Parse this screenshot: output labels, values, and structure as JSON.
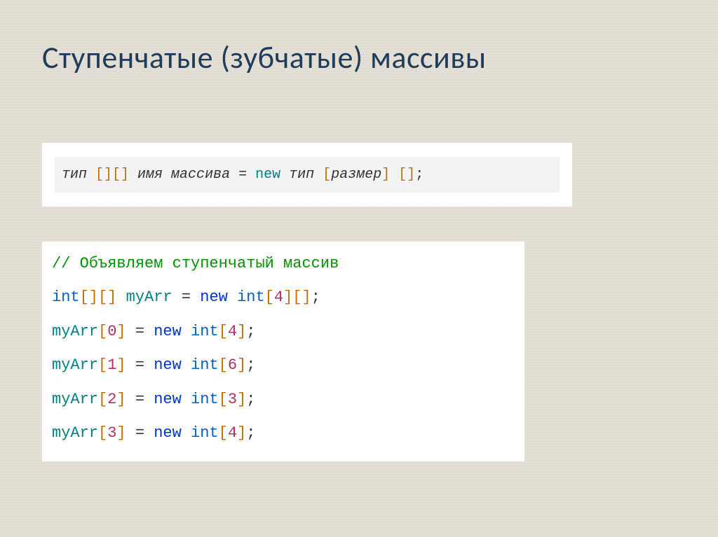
{
  "title": "Ступенчатые (зубчатые) массивы",
  "syntax": {
    "type_word": "тип",
    "name_phrase": "имя массива",
    "new_kw": "new",
    "size_word": "размер"
  },
  "code": {
    "comment": "// Объявляем ступенчатый массив",
    "decl_type": "int",
    "decl_name": "myArr",
    "decl_dim": "4",
    "assigns": [
      {
        "idx": "0",
        "size": "4"
      },
      {
        "idx": "1",
        "size": "6"
      },
      {
        "idx": "2",
        "size": "3"
      },
      {
        "idx": "3",
        "size": "4"
      }
    ],
    "new_kw": "new",
    "int_kw": "int"
  }
}
